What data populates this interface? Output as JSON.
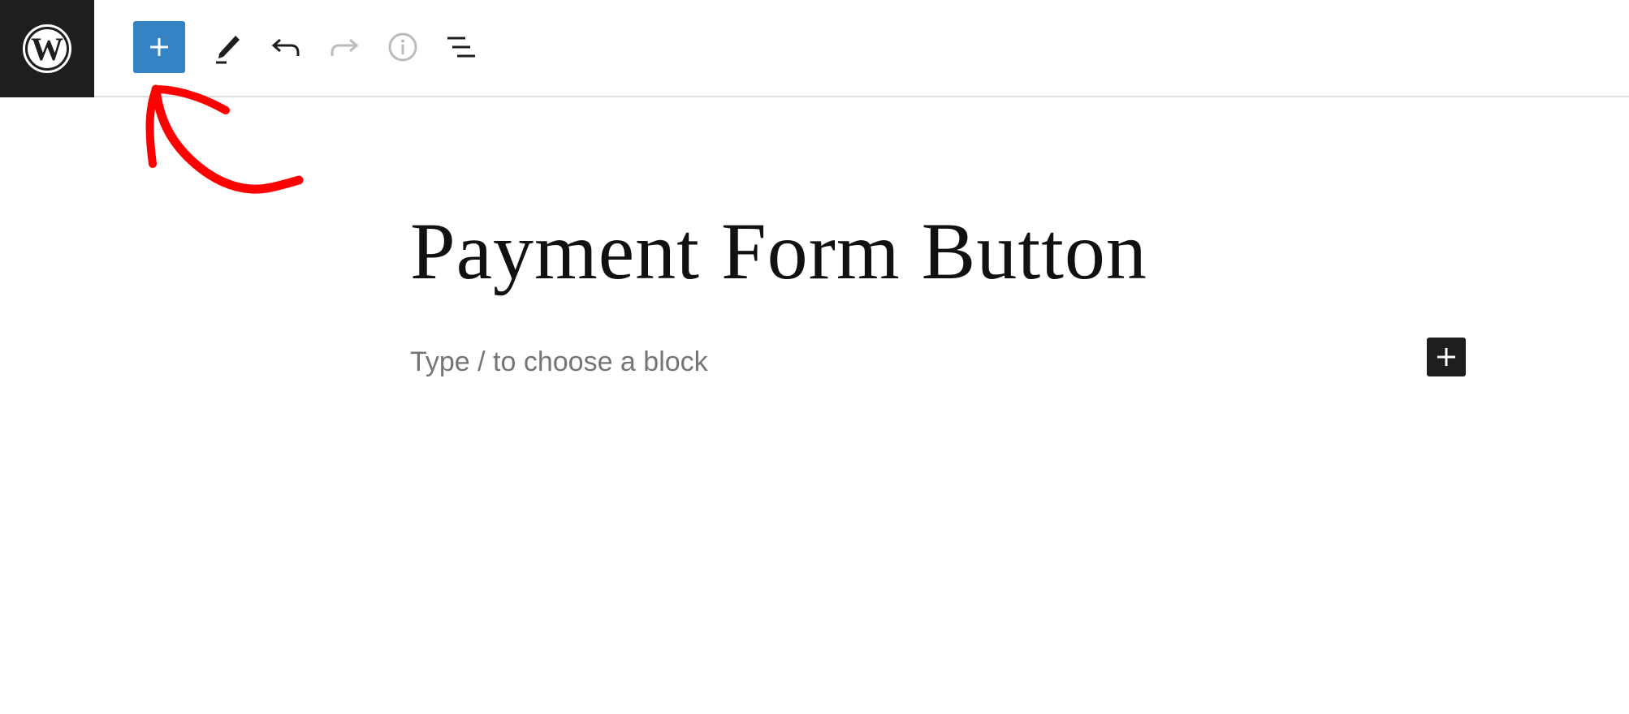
{
  "header": {
    "logo_icon": "wordpress-logo-icon",
    "tools": [
      {
        "name": "inserter",
        "icon": "plus-icon",
        "accent": "#3582c4"
      },
      {
        "name": "tools",
        "icon": "pencil-icon"
      },
      {
        "name": "undo",
        "icon": "undo-icon"
      },
      {
        "name": "redo",
        "icon": "redo-icon",
        "disabled": true
      },
      {
        "name": "details",
        "icon": "info-icon",
        "disabled": true
      },
      {
        "name": "list-view",
        "icon": "list-view-icon"
      }
    ]
  },
  "editor": {
    "title": "Payment Form Button",
    "placeholder": "Type / to choose a block",
    "add_block_icon": "plus-icon"
  },
  "annotation": {
    "type": "arrow",
    "color": "#ff0000",
    "points_to": "inserter"
  },
  "colors": {
    "dark": "#1e1e1e",
    "accent": "#3582c4",
    "muted": "#757575",
    "disabled": "#bbbbbb",
    "annotation": "#ff0000"
  }
}
